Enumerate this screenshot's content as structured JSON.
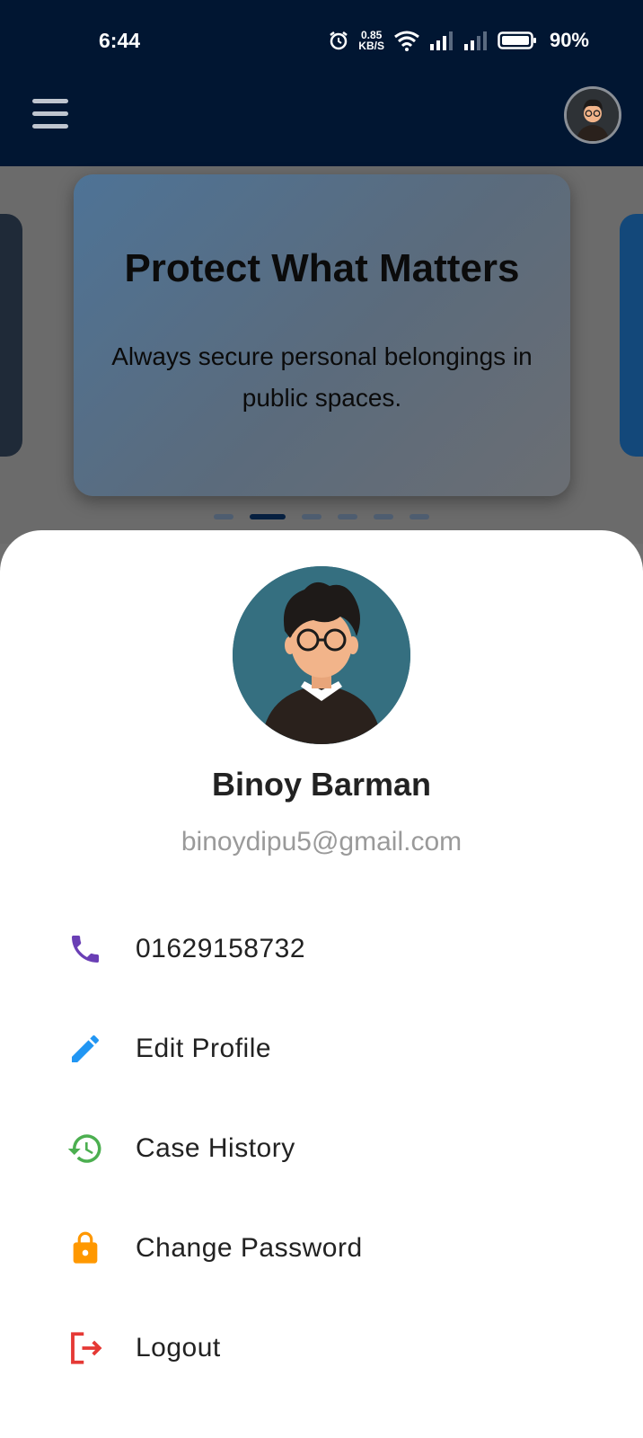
{
  "status_bar": {
    "time": "6:44",
    "speed_value": "0.85",
    "speed_unit": "KB/S",
    "battery": "90%"
  },
  "app_bar": {
    "menu_icon": "hamburger-menu-icon",
    "avatar_icon": "user-avatar"
  },
  "carousel": {
    "title": "Protect What Matters",
    "text": "Always secure personal belongings in public spaces.",
    "slide_count": 6,
    "active_index": 1
  },
  "profile": {
    "name": "Binoy Barman",
    "email": "binoydipu5@gmail.com"
  },
  "menu": {
    "phone": {
      "label": "01629158732",
      "icon": "phone-icon",
      "color": "#6a3fb5"
    },
    "edit": {
      "label": "Edit Profile",
      "icon": "pencil-icon",
      "color": "#2196f3"
    },
    "history": {
      "label": "Case History",
      "icon": "history-icon",
      "color": "#4caf50"
    },
    "password": {
      "label": "Change Password",
      "icon": "lock-icon",
      "color": "#ff9800"
    },
    "logout": {
      "label": "Logout",
      "icon": "logout-icon",
      "color": "#e53935"
    }
  },
  "colors": {
    "app_bar": "#011632",
    "sheet": "#ffffff"
  }
}
